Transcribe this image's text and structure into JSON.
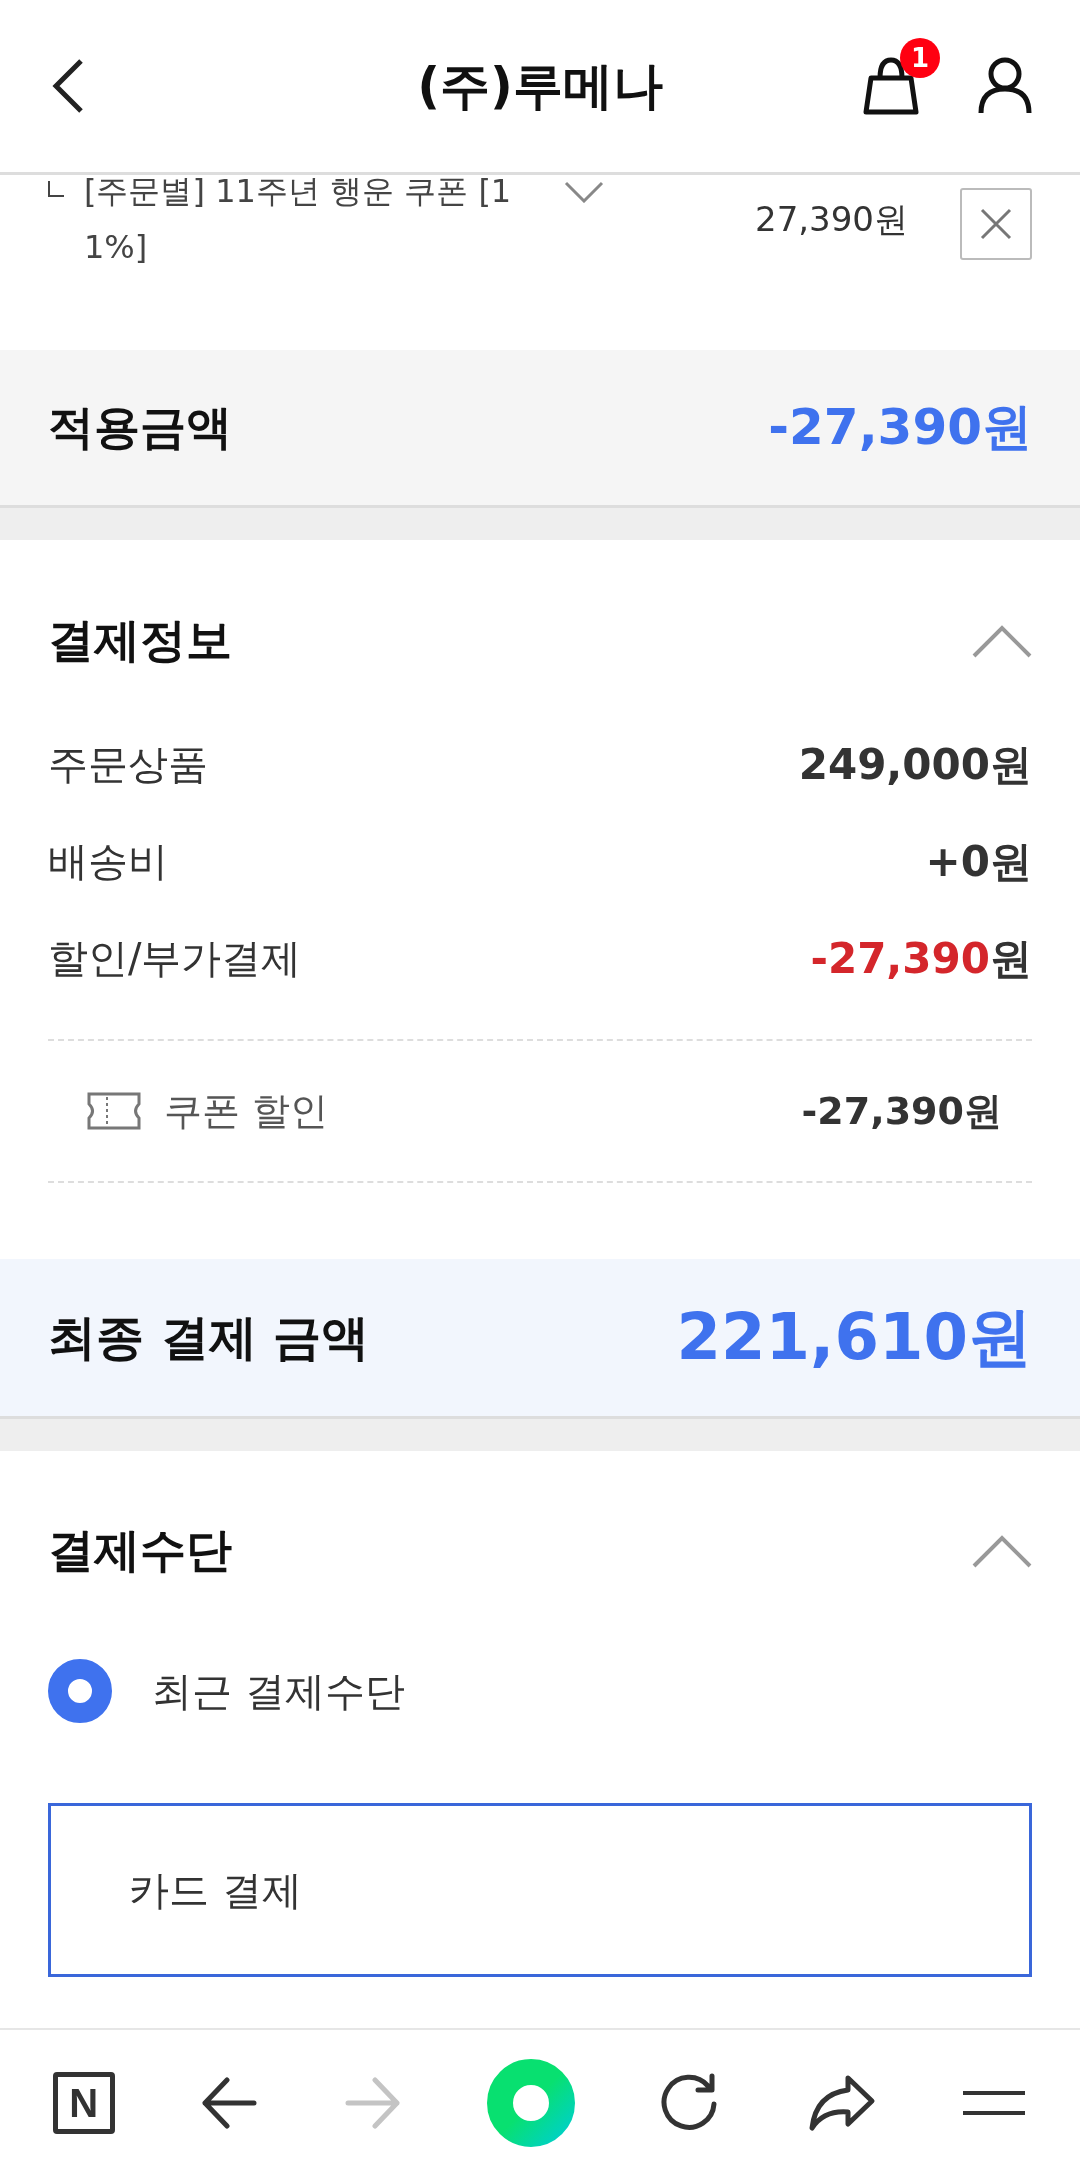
{
  "header": {
    "title": "(주)루메나",
    "cart_badge": "1"
  },
  "coupon": {
    "name": "[주문별] 11주년 행운 쿠폰 [11%]",
    "amount": "27,390원"
  },
  "applied": {
    "label": "적용금액",
    "amount": "-27,390원"
  },
  "payment_info": {
    "title": "결제정보",
    "expanded": true,
    "rows": [
      {
        "label": "주문상품",
        "value": "249,000원",
        "kind": "plain"
      },
      {
        "label": "배송비",
        "value": "+0원",
        "kind": "plain"
      },
      {
        "label": "할인/부가결제",
        "value": "-27,390",
        "unit": "원",
        "kind": "discount"
      }
    ],
    "details": [
      {
        "label": "쿠폰 할인",
        "value": "-27,390원"
      }
    ]
  },
  "final": {
    "label": "최종 결제 금액",
    "amount": "221,610원"
  },
  "payment_method": {
    "title": "결제수단",
    "expanded": true,
    "options": [
      {
        "label": "최근 결제수단",
        "selected": true
      }
    ],
    "method": "카드 결제"
  },
  "bottom_nav": {
    "logo": "N"
  }
}
